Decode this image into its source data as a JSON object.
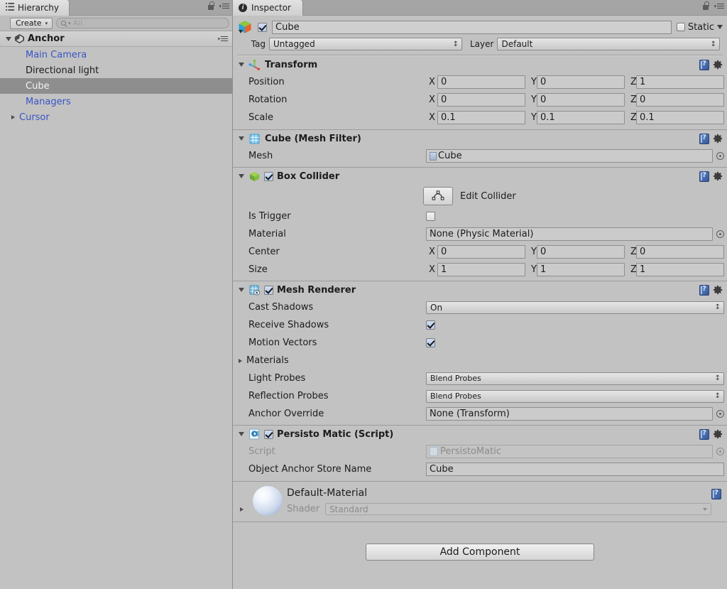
{
  "hierarchy": {
    "tab_label": "Hierarchy",
    "tab_icon": "hierarchy-list-icon",
    "lock_icon": "lock-icon",
    "menu_icon": "panel-menu-icon",
    "create_label": "Create",
    "search_placeholder": "All",
    "search_value": "",
    "search_icon": "search-icon",
    "root": {
      "label": "Anchor",
      "icon": "unity-scene-icon",
      "expanded": true
    },
    "items": [
      {
        "label": "Main Camera",
        "indent": 1,
        "kind": "prefab",
        "selected": false,
        "expandable": false
      },
      {
        "label": "Directional light",
        "indent": 1,
        "kind": "plain",
        "selected": false,
        "expandable": false
      },
      {
        "label": "Cube",
        "indent": 1,
        "kind": "plain",
        "selected": true,
        "expandable": false
      },
      {
        "label": "Managers",
        "indent": 1,
        "kind": "prefab",
        "selected": false,
        "expandable": false
      },
      {
        "label": "Cursor",
        "indent": 1,
        "kind": "prefab",
        "selected": false,
        "expandable": true
      }
    ]
  },
  "inspector": {
    "tab_label": "Inspector",
    "tab_icon": "info-icon",
    "lock_icon": "lock-icon",
    "menu_icon": "panel-menu-icon",
    "gameobject": {
      "icon": "cube-gameobject-icon",
      "enabled": true,
      "name": "Cube",
      "static_label": "Static",
      "static_checked": false,
      "tag_label": "Tag",
      "tag_value": "Untagged",
      "layer_label": "Layer",
      "layer_value": "Default"
    },
    "components": [
      {
        "id": "transform",
        "title": "Transform",
        "icon": "transform-axis-icon",
        "expanded": true,
        "has_enable_checkbox": false,
        "rows": [
          {
            "type": "vector3",
            "label": "Position",
            "x": "0",
            "y": "0",
            "z": "1"
          },
          {
            "type": "vector3",
            "label": "Rotation",
            "x": "0",
            "y": "0",
            "z": "0"
          },
          {
            "type": "vector3",
            "label": "Scale",
            "x": "0.1",
            "y": "0.1",
            "z": "0.1"
          }
        ]
      },
      {
        "id": "mesh-filter",
        "title": "Cube (Mesh Filter)",
        "icon": "mesh-filter-icon",
        "expanded": true,
        "has_enable_checkbox": false,
        "rows": [
          {
            "type": "object",
            "label": "Mesh",
            "value": "Cube",
            "chip": "mesh-chip-icon"
          }
        ]
      },
      {
        "id": "box-collider",
        "title": "Box Collider",
        "icon": "box-collider-icon",
        "expanded": true,
        "has_enable_checkbox": true,
        "enabled": true,
        "edit_collider_label": "Edit Collider",
        "edit_collider_icon": "collider-edit-icon",
        "rows": [
          {
            "type": "checkbox",
            "label": "Is Trigger",
            "checked": false
          },
          {
            "type": "object",
            "label": "Material",
            "value": "None (Physic Material)"
          },
          {
            "type": "vector3",
            "label": "Center",
            "x": "0",
            "y": "0",
            "z": "0"
          },
          {
            "type": "vector3",
            "label": "Size",
            "x": "1",
            "y": "1",
            "z": "1"
          }
        ]
      },
      {
        "id": "mesh-renderer",
        "title": "Mesh Renderer",
        "icon": "mesh-renderer-icon",
        "expanded": true,
        "has_enable_checkbox": true,
        "enabled": true,
        "rows": [
          {
            "type": "popup",
            "label": "Cast Shadows",
            "value": "On"
          },
          {
            "type": "checkbox",
            "label": "Receive Shadows",
            "checked": true
          },
          {
            "type": "checkbox",
            "label": "Motion Vectors",
            "checked": true
          },
          {
            "type": "foldout",
            "label": "Materials",
            "expanded": false
          },
          {
            "type": "popup",
            "label": "Light Probes",
            "value": "Blend Probes"
          },
          {
            "type": "popup",
            "label": "Reflection Probes",
            "value": "Blend Probes"
          },
          {
            "type": "object",
            "label": "Anchor Override",
            "value": "None (Transform)"
          }
        ]
      },
      {
        "id": "persisto-matic",
        "title": "Persisto Matic (Script)",
        "icon": "cs-script-icon",
        "expanded": true,
        "has_enable_checkbox": true,
        "enabled": true,
        "rows": [
          {
            "type": "object",
            "label": "Script",
            "value": "PersistoMatic",
            "disabled": true,
            "chip": "cs-script-chip-icon"
          },
          {
            "type": "text",
            "label": "Object Anchor Store Name",
            "value": "Cube"
          }
        ]
      }
    ],
    "material_preview": {
      "name": "Default-Material",
      "preview_icon": "material-sphere-preview",
      "shader_label": "Shader",
      "shader_value": "Standard",
      "expanded": false,
      "help_icon": "help-book-icon"
    },
    "add_component_label": "Add Component"
  },
  "icons": {
    "help": "help-book-icon",
    "gear": "gear-icon",
    "reference_picker": "object-picker-dot-icon"
  },
  "colors": {
    "panel_bg": "#c2c2c2",
    "tab_bar_bg": "#a5a5a5",
    "selection_bg": "#8e8e8e",
    "prefab_text": "#3a55c4",
    "field_bg": "#cbcbcb",
    "separator": "#9c9c9c"
  }
}
